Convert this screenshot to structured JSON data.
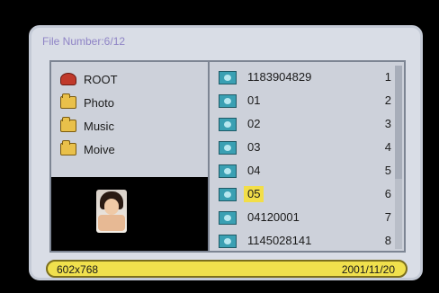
{
  "top_caption": "",
  "header": {
    "file_number": "File Number:6/12"
  },
  "left_pane": {
    "items": [
      {
        "label": "ROOT",
        "icon": "root-icon"
      },
      {
        "label": "Photo",
        "icon": "folder-icon"
      },
      {
        "label": "Music",
        "icon": "folder-icon"
      },
      {
        "label": "Moive",
        "icon": "folder-icon"
      }
    ]
  },
  "file_list": {
    "rows": [
      {
        "name": "1183904829",
        "index": "1"
      },
      {
        "name": "01",
        "index": "2"
      },
      {
        "name": "02",
        "index": "3"
      },
      {
        "name": "03",
        "index": "4"
      },
      {
        "name": "04",
        "index": "5"
      },
      {
        "name": "05",
        "index": "6",
        "selected": true
      },
      {
        "name": "04120001",
        "index": "7"
      },
      {
        "name": "1145028141",
        "index": "8"
      }
    ]
  },
  "status": {
    "resolution": "602x768",
    "date": "2001/11/20"
  },
  "colors": {
    "accent": "#f2de48",
    "panel": "#cdd1da",
    "frame": "#d9dde6"
  }
}
